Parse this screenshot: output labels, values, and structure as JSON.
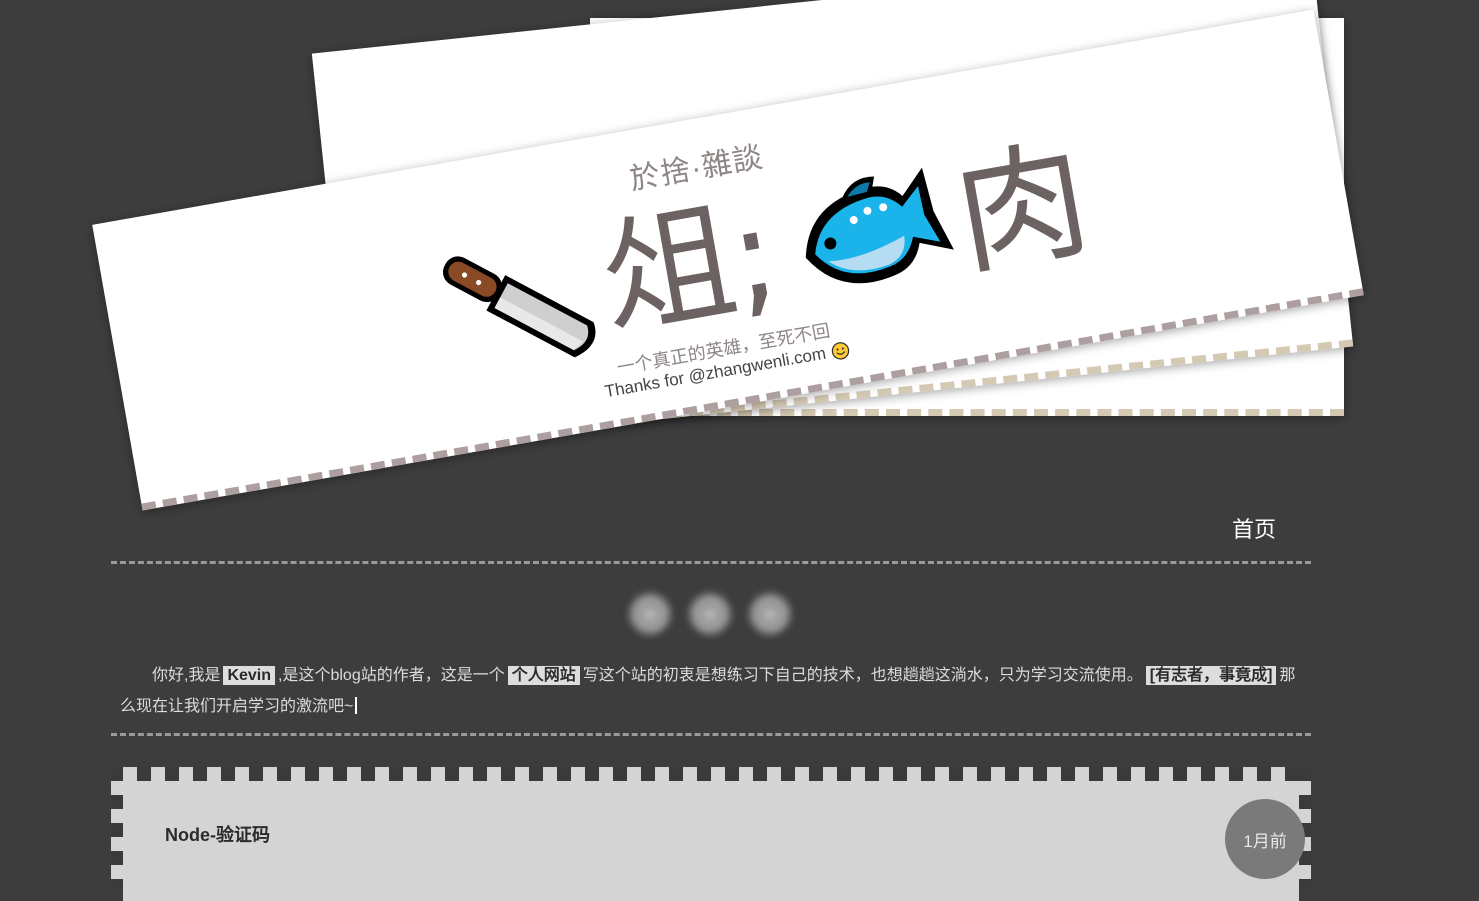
{
  "header": {
    "site_name": "於捨·雜談",
    "title_char_1": "俎;",
    "title_char_2": "肉",
    "title_icons": [
      "knife-icon",
      "fish-icon"
    ],
    "motto": "一个真正的英雄，至死不回",
    "thanks": "Thanks for @zhangwenli.com",
    "thanks_icon": "smile-icon"
  },
  "nav": {
    "home_label": "首页"
  },
  "socials": [
    {
      "icon": "social-icon-1",
      "label": "◉"
    },
    {
      "icon": "social-icon-2",
      "label": "◉"
    },
    {
      "icon": "social-icon-3",
      "label": "◉"
    }
  ],
  "intro": {
    "part1": "你好,我是",
    "name": "Kevin",
    "part2": ",是这个blog站的作者，这是一个",
    "site_kind": "个人网站",
    "part3": "写这个站的初衷是想练习下自己的技术，也想趟趟这淌水，只为学习交流使用。",
    "quote": "[有志者，事竟成]",
    "part4": "那么现在让我们开启学习的激流吧~"
  },
  "posts": [
    {
      "title": "Node-验证码",
      "date": "1月前"
    }
  ],
  "colors": {
    "background": "#3d3d3d",
    "card": "#ffffff",
    "title_text": "#6d6262",
    "post_bg": "#d4d4d4",
    "highlight_bg": "#dddddd"
  }
}
